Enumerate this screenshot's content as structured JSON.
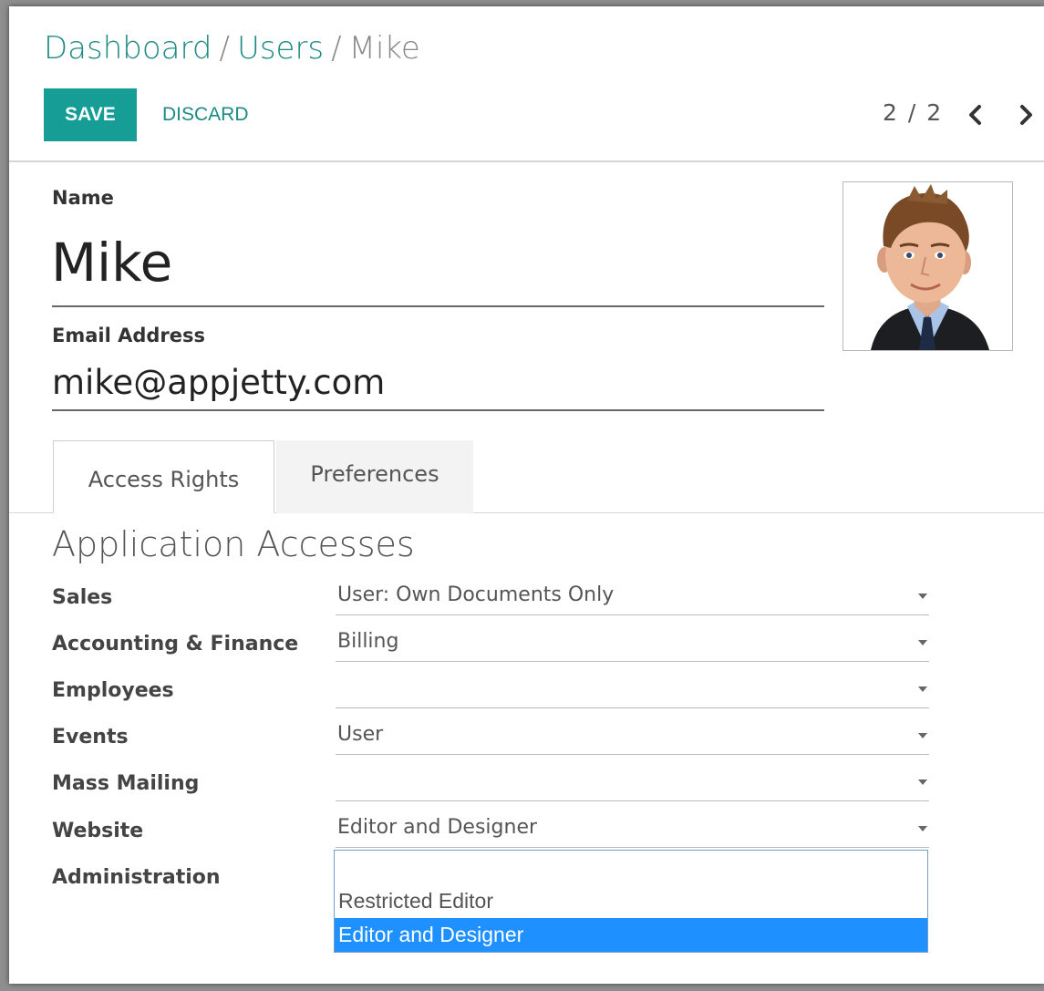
{
  "breadcrumb": {
    "items": [
      "Dashboard",
      "Users"
    ],
    "separator": "/",
    "current": "Mike"
  },
  "toolbar": {
    "save_label": "SAVE",
    "discard_label": "DISCARD"
  },
  "pager": {
    "value": "2 / 2",
    "prev_icon": "chevron-left-icon",
    "next_icon": "chevron-right-icon"
  },
  "form": {
    "name_label": "Name",
    "name_value": "Mike",
    "email_label": "Email Address",
    "email_value": "mike@appjetty.com",
    "avatar_icon": "user-photo"
  },
  "tabs": [
    {
      "label": "Access Rights",
      "active": true
    },
    {
      "label": "Preferences",
      "active": false
    }
  ],
  "access": {
    "title": "Application Accesses",
    "rows": [
      {
        "label": "Sales",
        "value": "User: Own Documents Only"
      },
      {
        "label": "Accounting & Finance",
        "value": "Billing"
      },
      {
        "label": "Employees",
        "value": ""
      },
      {
        "label": "Events",
        "value": "User"
      },
      {
        "label": "Mass Mailing",
        "value": ""
      },
      {
        "label": "Website",
        "value": "Editor and Designer"
      },
      {
        "label": "Administration",
        "value": ""
      }
    ],
    "dropdown": {
      "options": [
        "",
        "Restricted Editor",
        "Editor and Designer"
      ],
      "highlighted": "Editor and Designer"
    }
  },
  "colors": {
    "brand_teal": "#159d96",
    "link_teal": "#1d8a83",
    "selected_option": "#1e90ff"
  }
}
